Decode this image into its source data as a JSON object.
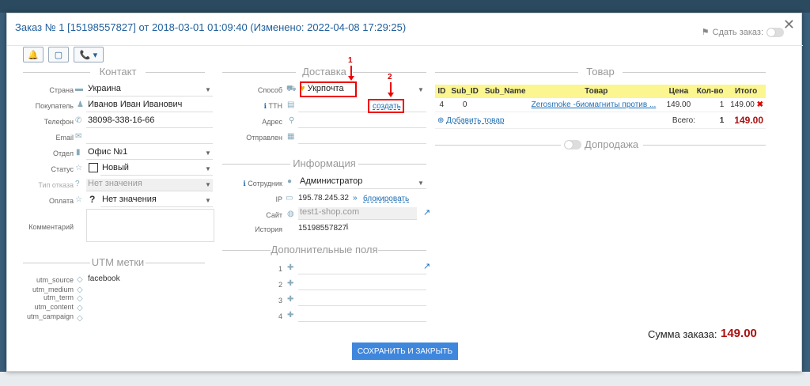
{
  "header": {
    "title": "Заказ № 1 [15198557827] от 2018-03-01 01:09:40 (Изменено: 2022-04-08 17:29:25)",
    "share_label": "Сдать заказ:"
  },
  "toolbar": {
    "bell": "🔔",
    "square": "▢",
    "phone": "📞 ▾"
  },
  "contact": {
    "section_title": "Контакт",
    "country_label": "Страна",
    "country_value": "Украина",
    "buyer_label": "Покупатель",
    "buyer_value": "Иванов Иван Иванович",
    "phone_label": "Телефон",
    "phone_value": "38098-338-16-66",
    "email_label": "Email",
    "email_value": "",
    "dept_label": "Отдел",
    "dept_value": "Офис №1",
    "status_label": "Статус",
    "status_value": "Новый",
    "refusal_label": "Тип отказа",
    "refusal_value": "Нет значения",
    "payment_label": "Оплата",
    "payment_value": "Нет значения",
    "comment_label": "Комментарий"
  },
  "utm": {
    "section_title": "UTM метки",
    "rows": [
      {
        "label": "utm_source",
        "value": "facebook"
      },
      {
        "label": "utm_medium",
        "value": ""
      },
      {
        "label": "utm_term",
        "value": ""
      },
      {
        "label": "utm_content",
        "value": ""
      },
      {
        "label": "utm_campaign",
        "value": ""
      }
    ]
  },
  "delivery": {
    "section_title": "Доставка",
    "method_label": "Способ",
    "method_value": "Укрпочта",
    "ttn_label": "ТТН",
    "create_link": "создать",
    "address_label": "Адрес",
    "sent_label": "Отправлен",
    "marker1": "1",
    "marker2": "2"
  },
  "info": {
    "section_title": "Информация",
    "employee_label": "Сотрудник",
    "employee_value": "Администратор",
    "ip_label": "IP",
    "ip_value": "195.78.245.32",
    "block_link": "блокировать",
    "site_label": "Сайт",
    "site_value": "test1-shop.com",
    "history_label": "История",
    "history_value": "15198557827"
  },
  "extra": {
    "section_title": "Дополнительные поля",
    "rows": [
      "1",
      "2",
      "3",
      "4"
    ]
  },
  "goods": {
    "section_title": "Товар",
    "columns": [
      "ID",
      "Sub_ID",
      "Sub_Name",
      "Товар",
      "Цена",
      "Кол-во",
      "Итого"
    ],
    "row": {
      "id": "4",
      "sub_id": "0",
      "sub_name": "",
      "name": "Zerosmoke -биомагниты против ...",
      "price": "149.00",
      "qty": "1",
      "total": "149.00"
    },
    "add_label": "Добавить товар",
    "total_label": "Всего:",
    "total_qty": "1",
    "total_sum": "149.00",
    "upsell_label": "Допродажа"
  },
  "footer": {
    "save_label": "СОХРАНИТЬ И ЗАКРЫТЬ",
    "sum_label": "Сумма заказа:",
    "sum_value": "149.00"
  },
  "colors": {
    "accent": "#3f86dd",
    "title": "#1f5f9c",
    "highlight": "#e00000",
    "total": "#aa1111"
  }
}
